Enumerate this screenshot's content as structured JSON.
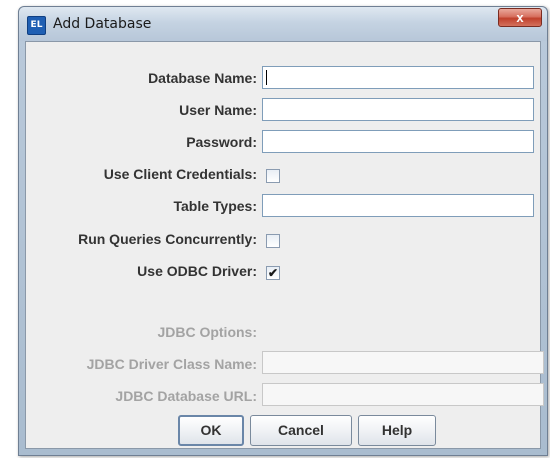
{
  "window": {
    "title": "Add Database",
    "close_symbol": "x",
    "app_icon_text": "EL"
  },
  "form": {
    "database_name": {
      "label": "Database Name:",
      "value": ""
    },
    "user_name": {
      "label": "User Name:",
      "value": ""
    },
    "password": {
      "label": "Password:",
      "value": ""
    },
    "use_client_credentials": {
      "label": "Use Client Credentials:",
      "checked": false
    },
    "table_types": {
      "label": "Table Types:",
      "value": ""
    },
    "run_queries_concurrently": {
      "label": "Run Queries Concurrently:",
      "checked": false
    },
    "use_odbc_driver": {
      "label": "Use ODBC Driver:",
      "checked": true,
      "mark": "✔"
    },
    "jdbc_options": {
      "label": "JDBC Options:"
    },
    "jdbc_driver_class_name": {
      "label": "JDBC Driver Class Name:",
      "value": ""
    },
    "jdbc_database_url": {
      "label": "JDBC Database URL:",
      "value": ""
    }
  },
  "buttons": {
    "ok": "OK",
    "cancel": "Cancel",
    "help": "Help"
  }
}
